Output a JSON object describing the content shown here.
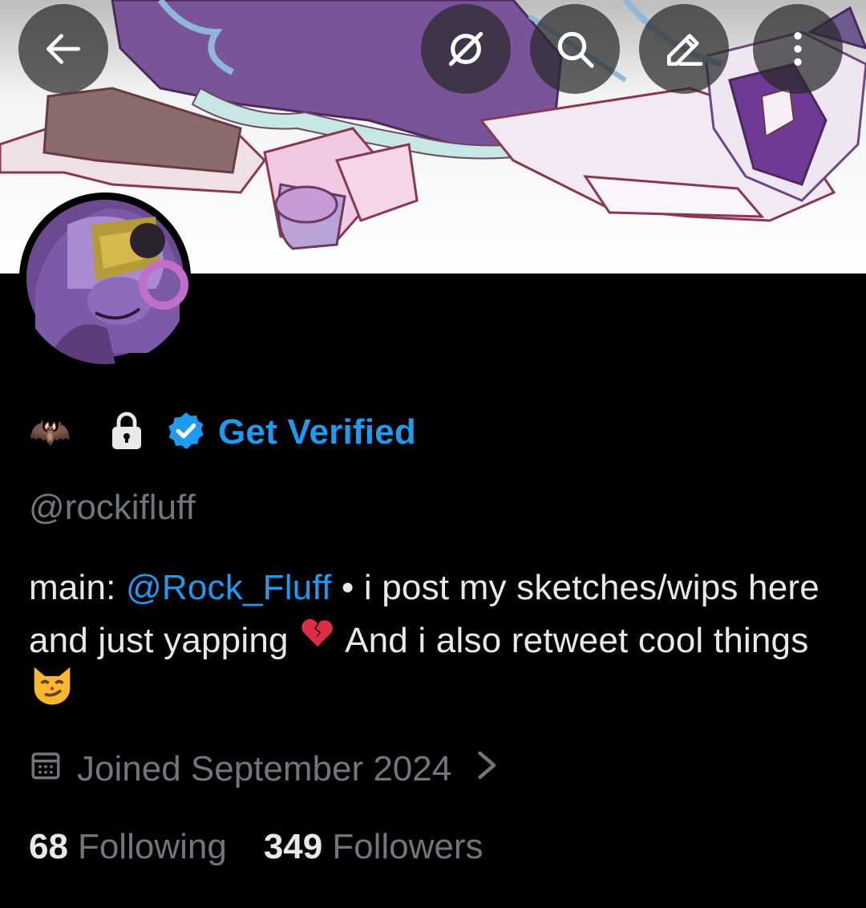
{
  "header": {
    "back": "arrow-left-icon",
    "actions": [
      "grok-icon",
      "search-icon",
      "edit-pencil-icon",
      "more-vertical-icon"
    ]
  },
  "profile": {
    "name_emoji": "🦇",
    "lock_icon": "lock-icon",
    "verified_icon": "verified-badge-icon",
    "get_verified_label": "Get Verified",
    "handle": "@rockifluff",
    "bio": {
      "prefix": "main: ",
      "mention": "@Rock_Fluff",
      "after_mention": " • i post my sketches/wips here and just yapping ",
      "emoji_1": "💔",
      "middle": " And i also retweet cool things ",
      "emoji_2": "😼"
    },
    "joined_label": "Joined September 2024",
    "joined_icon": "calendar-icon",
    "following_count": "68",
    "following_label": "Following",
    "followers_count": "349",
    "followers_label": "Followers"
  },
  "colors": {
    "accent": "#1d9bf0",
    "muted": "#71767b",
    "text": "#e7e9ea",
    "background": "#000000"
  }
}
